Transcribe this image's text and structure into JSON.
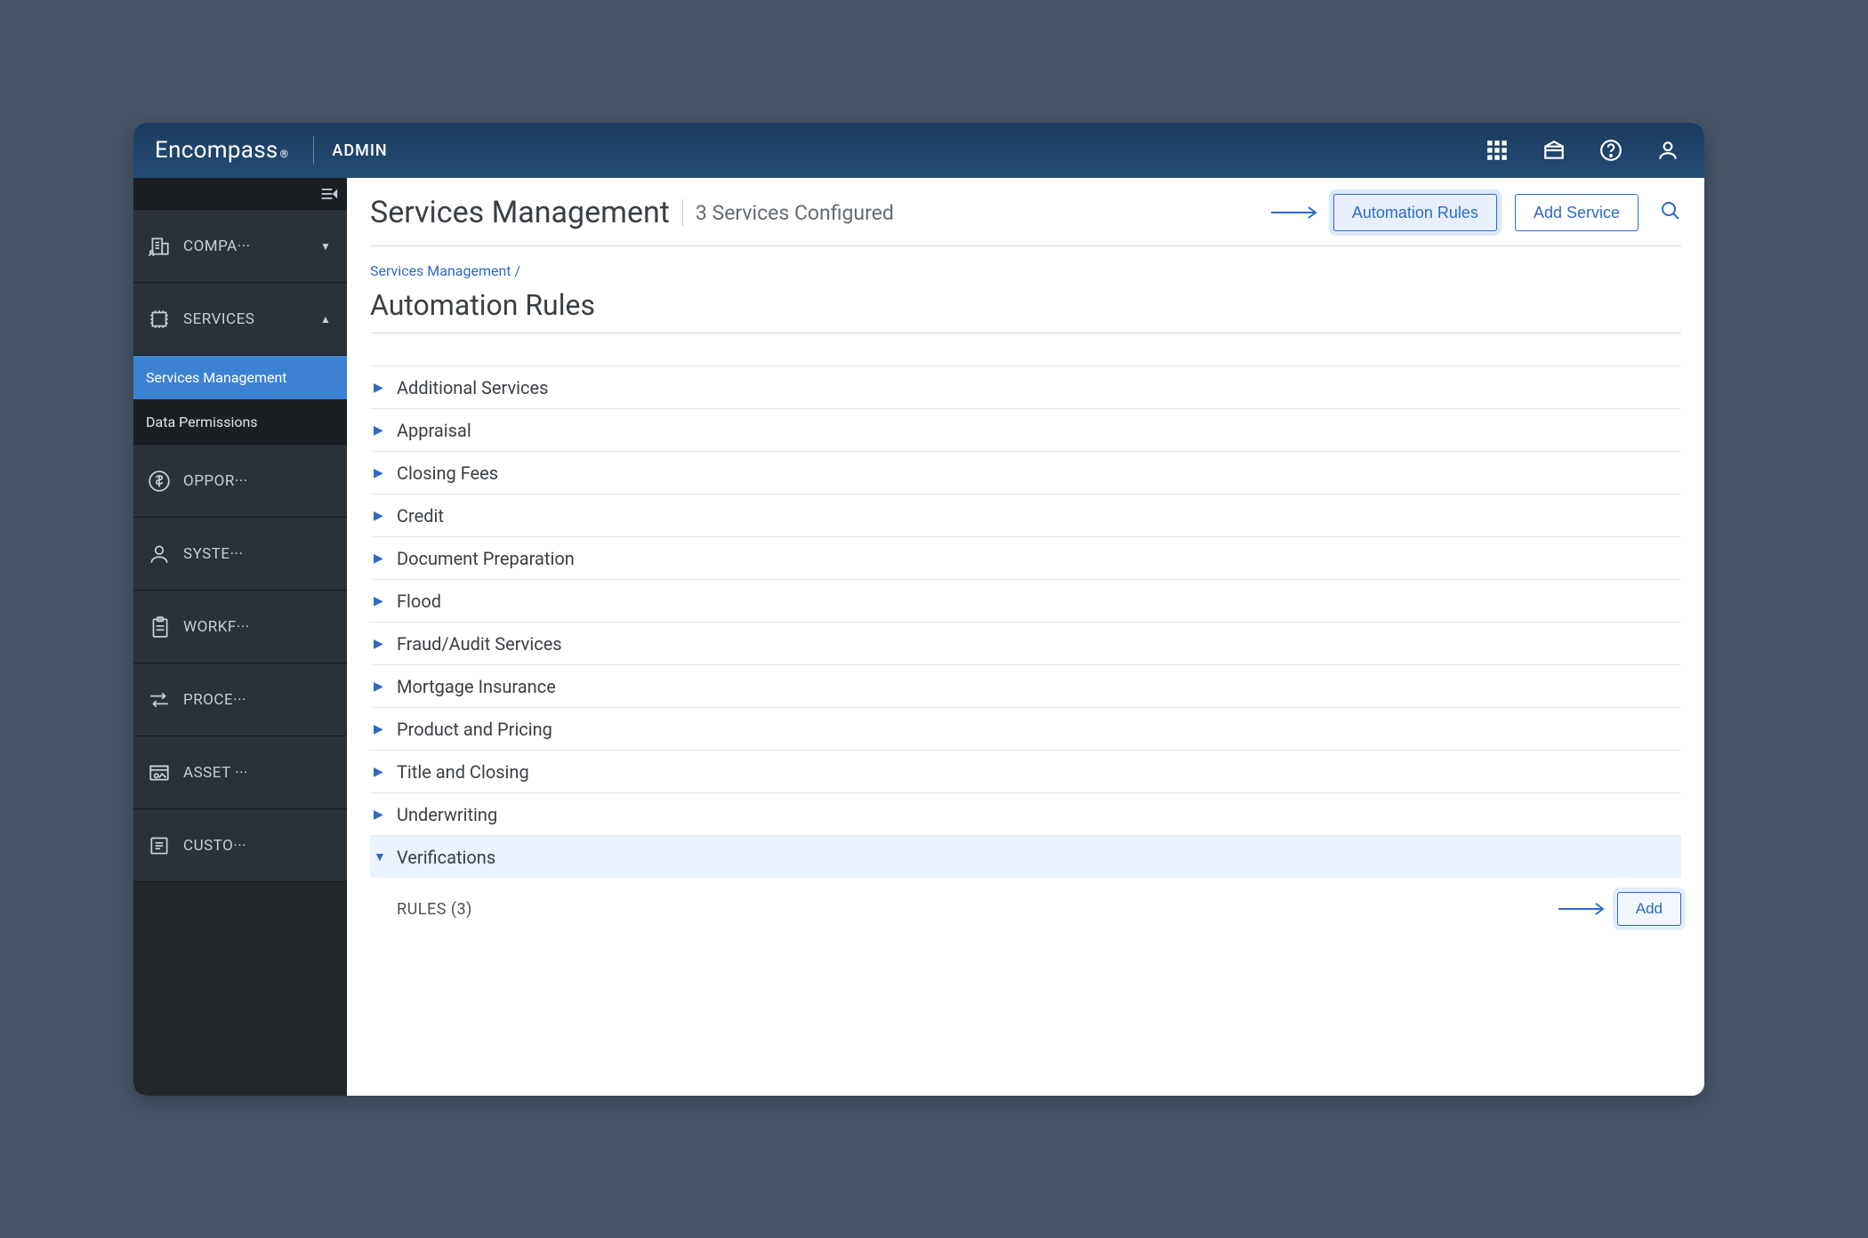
{
  "brand": {
    "name": "Encompass",
    "mark": "®"
  },
  "admin_label": "ADMIN",
  "sidebar": {
    "items": [
      {
        "label": "COMPA···",
        "icon": "company",
        "caret": "down"
      },
      {
        "label": "SERVICES",
        "icon": "services",
        "caret": "up",
        "sub": [
          {
            "label": "Services Management",
            "active": true
          },
          {
            "label": "Data Permissions",
            "active": false
          }
        ]
      },
      {
        "label": "OPPOR···",
        "icon": "opportunity"
      },
      {
        "label": "SYSTE···",
        "icon": "system"
      },
      {
        "label": "WORKF···",
        "icon": "workflow"
      },
      {
        "label": "PROCE···",
        "icon": "process"
      },
      {
        "label": "ASSET ···",
        "icon": "asset"
      },
      {
        "label": "CUSTO···",
        "icon": "custom"
      }
    ]
  },
  "header": {
    "title": "Services Management",
    "count": "3",
    "subtitle": "Services Configured",
    "automation_btn": "Automation Rules",
    "add_service_btn": "Add Service"
  },
  "breadcrumb": {
    "root": "Services Management",
    "slash": "/"
  },
  "section_title": "Automation Rules",
  "categories": [
    {
      "label": "Additional Services"
    },
    {
      "label": "Appraisal"
    },
    {
      "label": "Closing Fees"
    },
    {
      "label": "Credit"
    },
    {
      "label": "Document Preparation"
    },
    {
      "label": "Flood"
    },
    {
      "label": "Fraud/Audit Services"
    },
    {
      "label": "Mortgage Insurance"
    },
    {
      "label": "Product and Pricing"
    },
    {
      "label": "Title and Closing"
    },
    {
      "label": "Underwriting"
    },
    {
      "label": "Verifications",
      "expanded": true
    }
  ],
  "rules": {
    "label": "RULES (3)",
    "add_btn": "Add"
  }
}
